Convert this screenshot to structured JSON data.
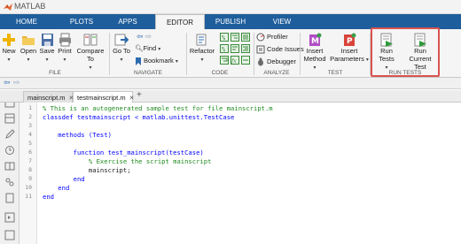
{
  "window": {
    "title": "MATLAB"
  },
  "tabs": [
    {
      "label": "HOME"
    },
    {
      "label": "PLOTS"
    },
    {
      "label": "APPS"
    },
    {
      "label": "EDITOR",
      "active": true
    },
    {
      "label": "PUBLISH"
    },
    {
      "label": "VIEW"
    }
  ],
  "ribbon": {
    "file": {
      "new": "New",
      "open": "Open",
      "save": "Save",
      "print": "Print",
      "compare_line1": "Compare To",
      "group": "FILE"
    },
    "navigate": {
      "goto": "Go To",
      "find": "Find",
      "bookmark": "Bookmark",
      "group": "NAVIGATE"
    },
    "code": {
      "refactor": "Refactor",
      "group": "CODE"
    },
    "analyze": {
      "profiler": "Profiler",
      "code_issues": "Code Issues",
      "debugger": "Debugger",
      "group": "ANALYZE"
    },
    "test": {
      "insert_method_1": "Insert",
      "insert_method_2": "Method",
      "insert_params_1": "Insert",
      "insert_params_2": "Parameters",
      "group": "TEST"
    },
    "run_tests": {
      "run_tests": "Run Tests",
      "run_current_1": "Run Current",
      "run_current_2": "Test",
      "group": "RUN TESTS"
    }
  },
  "editor": {
    "tabs": [
      {
        "label": "mainscript.m"
      },
      {
        "label": "testmainscript.m",
        "active": true
      }
    ],
    "add_tab": "+",
    "lines": [
      {
        "n": "1",
        "text": "% This is an autogenerated sample test for file mainscript.m"
      },
      {
        "n": "2",
        "text": "classdef testmainscript < matlab.unittest.TestCase"
      },
      {
        "n": "3",
        "text": ""
      },
      {
        "n": "4",
        "text": "    methods (Test)"
      },
      {
        "n": "5",
        "text": ""
      },
      {
        "n": "6",
        "text": "        function test_mainscript(testCase)"
      },
      {
        "n": "7",
        "text": "            % Exercise the script mainscript"
      },
      {
        "n": "8",
        "text": "            mainscript;"
      },
      {
        "n": "9",
        "text": "        end"
      },
      {
        "n": "10",
        "text": "    end"
      },
      {
        "n": "11",
        "text": "end"
      }
    ]
  },
  "colors": {
    "tab_bar": "#1f5e9c",
    "comment": "#228b22",
    "keyword": "#0000ff",
    "highlight": "#d9534f"
  }
}
